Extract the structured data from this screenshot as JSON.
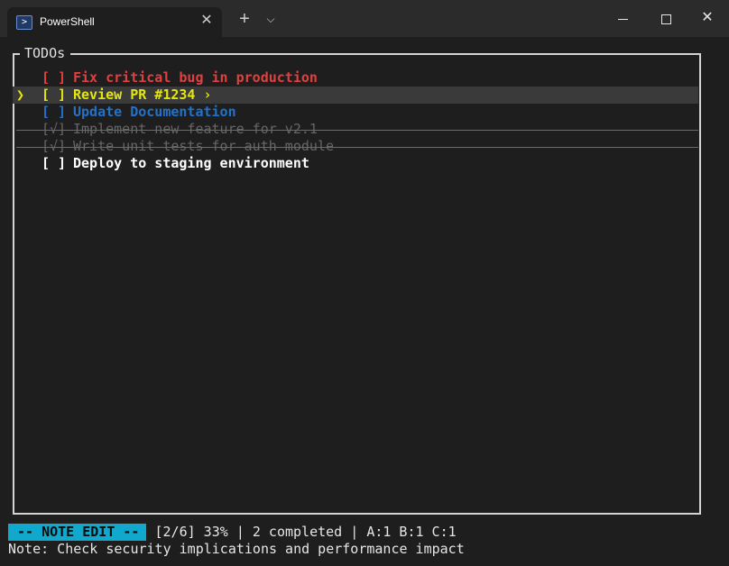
{
  "window": {
    "tab_title": "PowerShell",
    "tab_icon": "powershell-icon",
    "new_tab_glyph": "+",
    "dropdown_glyph": "⌵",
    "close_glyph": "✕"
  },
  "panel": {
    "title": "TODOs"
  },
  "todos": [
    {
      "checkbox": "[ ]",
      "text": "Fix critical bug in production",
      "color": "#e04040",
      "done": false,
      "selected": false,
      "priority": "A"
    },
    {
      "checkbox": "[ ]",
      "text": "Review PR #1234 ›",
      "color": "#e5e510",
      "done": false,
      "selected": true,
      "cursor": "❯",
      "priority": "B"
    },
    {
      "checkbox": "[ ]",
      "text": "Update Documentation",
      "color": "#2472c8",
      "done": false,
      "selected": false,
      "priority": "C"
    },
    {
      "checkbox": "[√]",
      "text": "Implement new feature for v2.1",
      "color": "#666666",
      "done": true,
      "selected": false
    },
    {
      "checkbox": "[√]",
      "text": "Write unit tests for auth module",
      "color": "#666666",
      "done": true,
      "selected": false
    },
    {
      "checkbox": "[ ]",
      "text": "Deploy to staging environment",
      "color": "#ffffff",
      "done": false,
      "selected": false
    }
  ],
  "status": {
    "mode": "-- NOTE EDIT --",
    "progress": "[2/6] 33%",
    "separator": "|",
    "completed": "2 completed",
    "priorities": "A:1 B:1 C:1"
  },
  "note": {
    "text": "Note: Check security implications and performance impact"
  },
  "colors": {
    "accent": "#11a8cd",
    "background": "#1e1e1e",
    "selection": "#3a3a3a"
  }
}
